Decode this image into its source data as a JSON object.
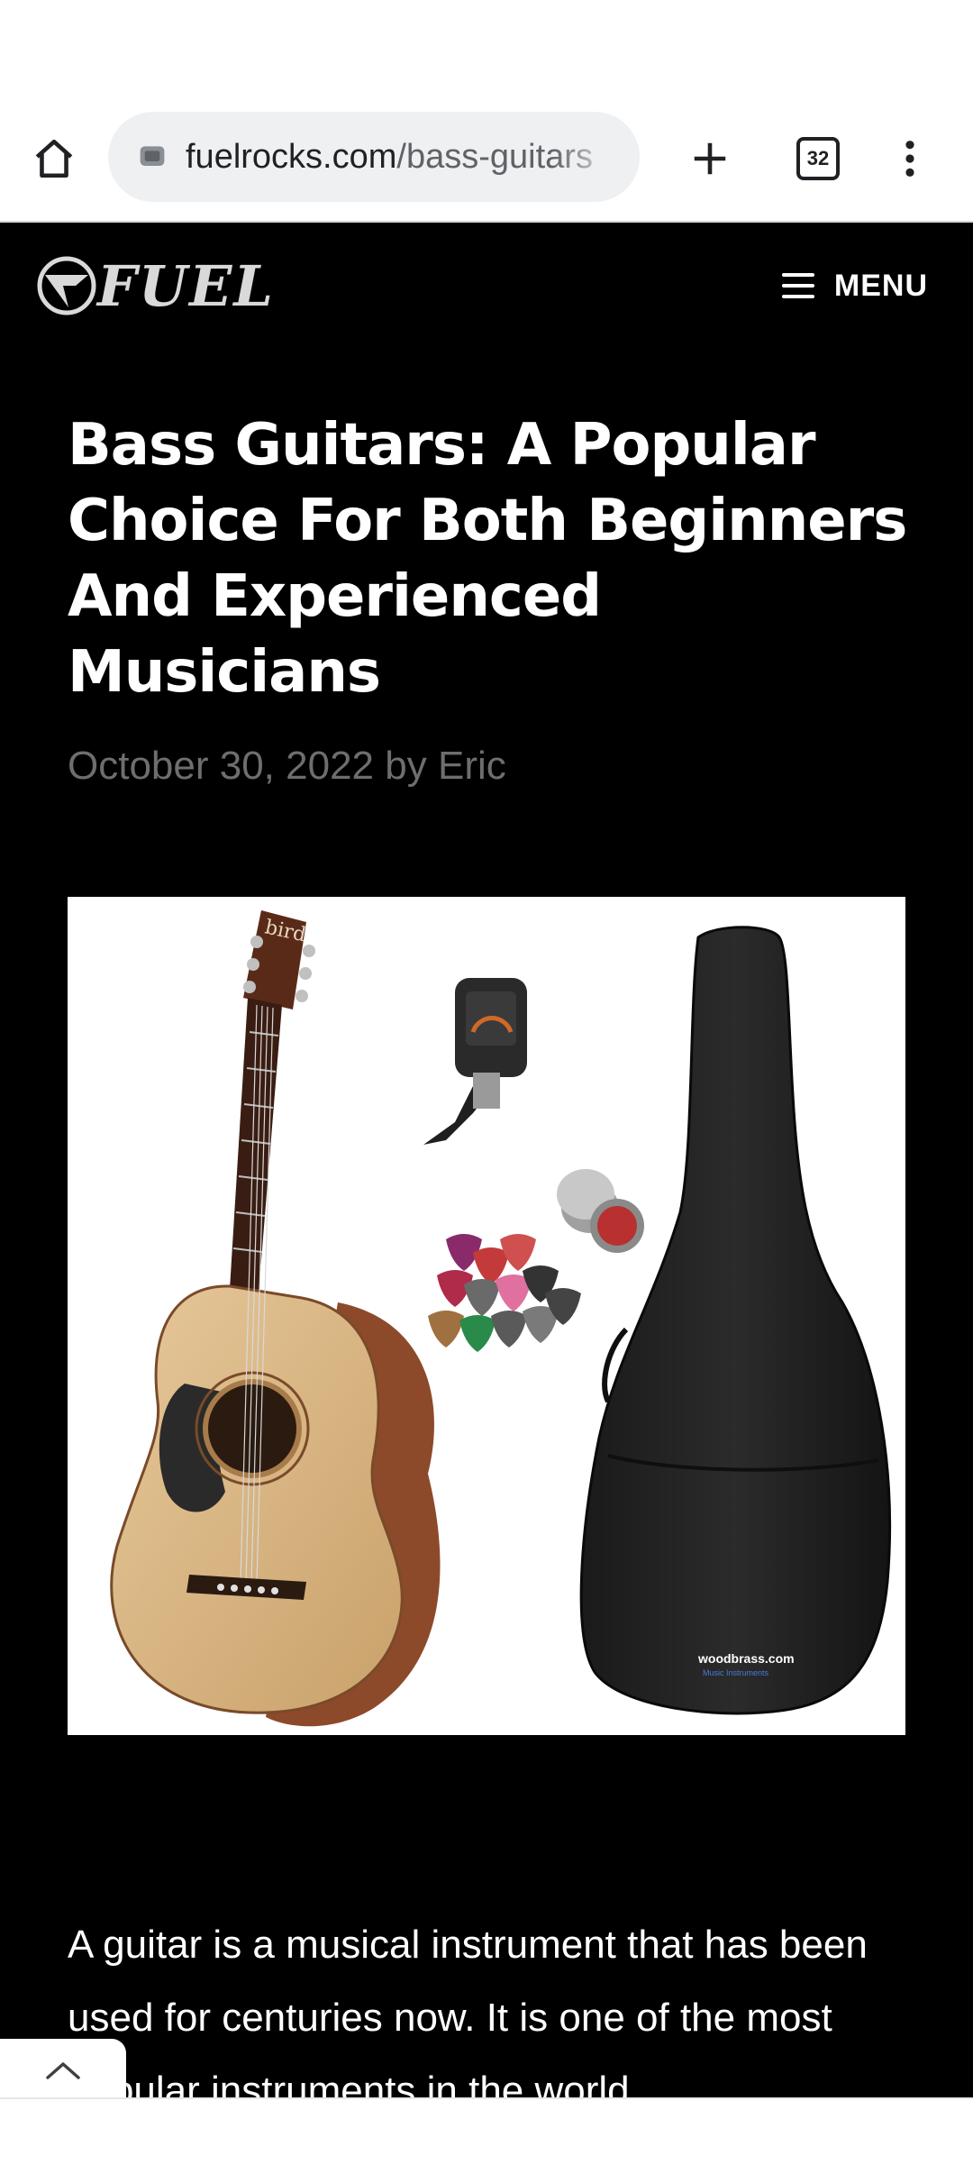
{
  "browser": {
    "url_domain": "fuelrocks.com",
    "url_path": "/bass-guitars",
    "tab_count": "32",
    "icons": {
      "home": "home-icon",
      "site_info": "site-info-icon",
      "new_tab": "plus-icon",
      "tabs": "tab-switcher-icon",
      "more": "more-vert-icon"
    }
  },
  "site": {
    "logo_text": "FUEL",
    "menu_label": "MENU"
  },
  "article": {
    "title": "Bass Guitars: A Popular Choice For Both Beginners And Experienced Musicians",
    "date": "October 30, 2022",
    "by": "by",
    "author": "Eric",
    "image_bag_brand": "woodbrass.com",
    "image_bag_sub": "Music Instruments",
    "image_guitar_brand": "bird",
    "body": "A guitar is a musical instrument that has been used for centuries now. It is one of the most popular instruments in the world"
  },
  "colors": {
    "page_bg": "#000000",
    "title": "#ffffff",
    "byline": "#6e6e6e",
    "url_bar_bg": "#eef0f2"
  }
}
